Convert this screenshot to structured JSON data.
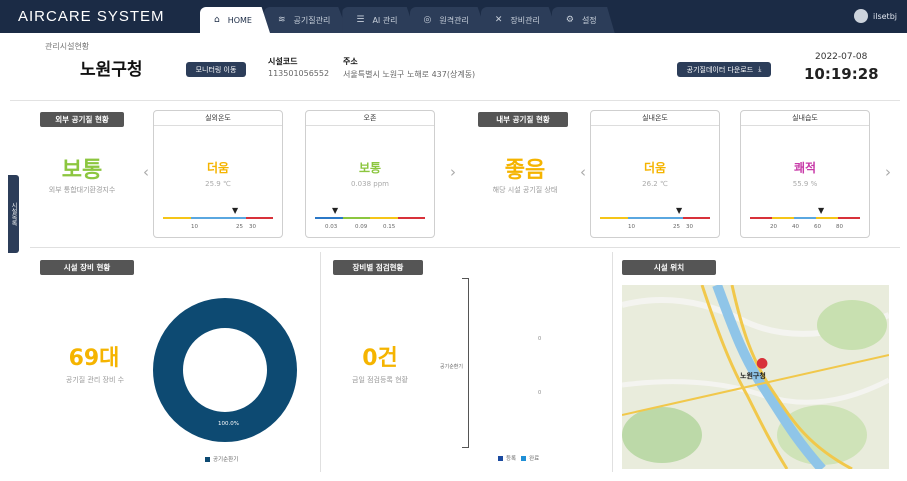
{
  "app": {
    "logo": "AIRCARE SYSTEM",
    "user_name": "ilsetbj"
  },
  "tabs": [
    {
      "label": "HOME",
      "icon": "home-icon",
      "active": true
    },
    {
      "label": "공기질관리",
      "icon": "airflow-icon",
      "active": false
    },
    {
      "label": "AI 관리",
      "icon": "list-icon",
      "active": false
    },
    {
      "label": "원격관리",
      "icon": "remote-icon",
      "active": false
    },
    {
      "label": "장비관리",
      "icon": "wrench-icon",
      "active": false
    },
    {
      "label": "설정",
      "icon": "gear-icon",
      "active": false
    }
  ],
  "header": {
    "breadcrumb": "관리시설현황",
    "facility_name": "노원구청",
    "monitor_button": "모니터링 이동",
    "code_label": "시설코드",
    "code_value": "113501056552",
    "address_label": "주소",
    "address_value": "서울특별시 노원구 노해로 437(상계동)",
    "download_button": "공기질데이터 다운로드",
    "date": "2022-07-08",
    "time": "10:19:28"
  },
  "outdoor": {
    "section_title": "외부 공기질 현황",
    "status": "보통",
    "status_color": "#8cc63f",
    "caption": "외부 통합대기환경지수",
    "cards": [
      {
        "title": "실외온도",
        "status": "더움",
        "status_color": "#f5b400",
        "value": "25.9 ℃",
        "ticks": [
          "10",
          "25",
          "30"
        ],
        "pin": 0.6
      },
      {
        "title": "오존",
        "status": "보통",
        "status_color": "#8cc63f",
        "value": "0.038 ppm",
        "ticks": [
          "0.03",
          "0.09",
          "0.15"
        ],
        "pin": 0.12
      }
    ]
  },
  "indoor": {
    "section_title": "내부 공기질 현황",
    "status": "좋음",
    "status_color": "#f5b400",
    "caption": "해당 시설 공기질 상태",
    "cards": [
      {
        "title": "실내온도",
        "status": "더움",
        "status_color": "#f5b400",
        "value": "26.2 ℃",
        "ticks": [
          "10",
          "25",
          "30"
        ],
        "pin": 0.62
      },
      {
        "title": "실내습도",
        "status": "쾌적",
        "status_color": "#c83aa8",
        "value": "55.9 %",
        "ticks": [
          "20",
          "40",
          "60",
          "80"
        ],
        "pin": 0.55
      }
    ]
  },
  "equipment": {
    "section_title": "시설 장비 현황",
    "count": "69대",
    "caption": "공기질 관리 장비 수",
    "donut_percent_label": "100.0%",
    "donut_color": "#0d4a72",
    "legend": "공기순환기"
  },
  "inspection": {
    "section_title": "장비별 점검현황",
    "count": "0건",
    "caption": "금일 점검등록 현황",
    "axis_category": "공기순환기",
    "y_ticks": [
      "0",
      "0"
    ],
    "legend": [
      {
        "label": "등록",
        "color": "#1b4aa0"
      },
      {
        "label": "완료",
        "color": "#1f8fd6"
      }
    ]
  },
  "location": {
    "section_title": "시설 위치",
    "marker_label": "노원구청"
  },
  "sidebar_tab": "시설목록"
}
